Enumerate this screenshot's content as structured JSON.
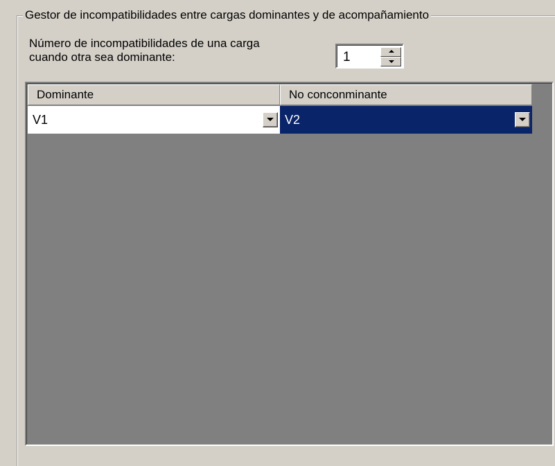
{
  "group": {
    "title": "Gestor de incompatibilidades entre cargas dominantes y de acompañamiento"
  },
  "count": {
    "label_line1": "Número de incompatibilidades de una carga",
    "label_line2": "cuando otra sea dominante:",
    "value": "1"
  },
  "grid": {
    "columns": [
      "Dominante",
      "No conconminante"
    ],
    "rows": [
      {
        "dominante": "V1",
        "no_concomitante": "V2",
        "selected_column": 1
      }
    ]
  },
  "colors": {
    "selection": "#0a246a",
    "grid_background": "#808080",
    "dialog_background": "#d4d0c8"
  },
  "icons": {
    "spinner_up": "triangle-up-icon",
    "spinner_down": "triangle-down-icon",
    "dropdown": "chevron-down-icon"
  }
}
